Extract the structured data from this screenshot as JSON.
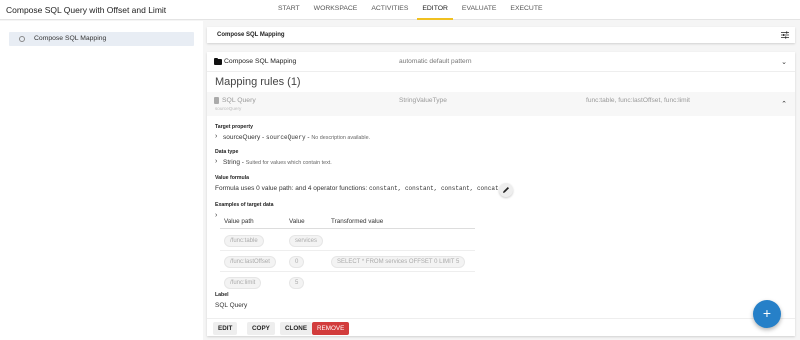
{
  "app": {
    "title": "Compose SQL Query with Offset and Limit"
  },
  "nav": {
    "tabs": [
      "START",
      "WORKSPACE",
      "ACTIVITIES",
      "EDITOR",
      "EVALUATE",
      "EXECUTE"
    ],
    "active": "EDITOR"
  },
  "sidebar": {
    "items": [
      {
        "label": "Compose SQL Mapping"
      }
    ]
  },
  "header": {
    "title": "Compose SQL Mapping"
  },
  "mapping": {
    "name": "Compose SQL Mapping",
    "pattern": "automatic default pattern"
  },
  "rules": {
    "heading": "Mapping rules (1)",
    "rule": {
      "name": "SQL Query",
      "source": "sourceQuery",
      "type": "StringValueType",
      "operators": "func:table, func:lastOffset, func:limit"
    }
  },
  "details": {
    "target_property_label": "Target property",
    "target_property": {
      "name": "sourceQuery",
      "sep1": " - ",
      "code": "sourceQuery",
      "sep2": " - ",
      "desc": "No description available."
    },
    "data_type_label": "Data type",
    "data_type": {
      "name": "String",
      "sep": " - ",
      "desc": "Suited for values which contain text."
    },
    "value_formula_label": "Value formula",
    "value_formula": {
      "text": "Formula uses 0 value path:  and 4 operator functions: ",
      "code": "constant, constant, constant, concat"
    },
    "examples_label": "Examples of target data",
    "examples": {
      "headers": [
        "Value path",
        "Value",
        "Transformed value"
      ],
      "rows": [
        {
          "path": "/func:table",
          "value": "services",
          "transformed": ""
        },
        {
          "path": "/func:lastOffset",
          "value": "0",
          "transformed": "SELECT * FROM services OFFSET 0 LIMIT 5"
        },
        {
          "path": "/func:limit",
          "value": "5",
          "transformed": ""
        }
      ]
    },
    "label_label": "Label",
    "label_value": "SQL Query"
  },
  "actions": {
    "edit": "EDIT",
    "copy": "COPY",
    "clone": "CLONE",
    "remove": "REMOVE"
  },
  "fab": {
    "label": "+"
  },
  "colors": {
    "accent_tab": "#f0c020",
    "remove": "#d23c3c",
    "fab": "#2680c8"
  },
  "icons": {
    "filter": "filter-sliders-icon",
    "folder": "folder-icon",
    "doc": "document-icon",
    "pencil": "pencil-icon",
    "add": "plus-icon"
  }
}
